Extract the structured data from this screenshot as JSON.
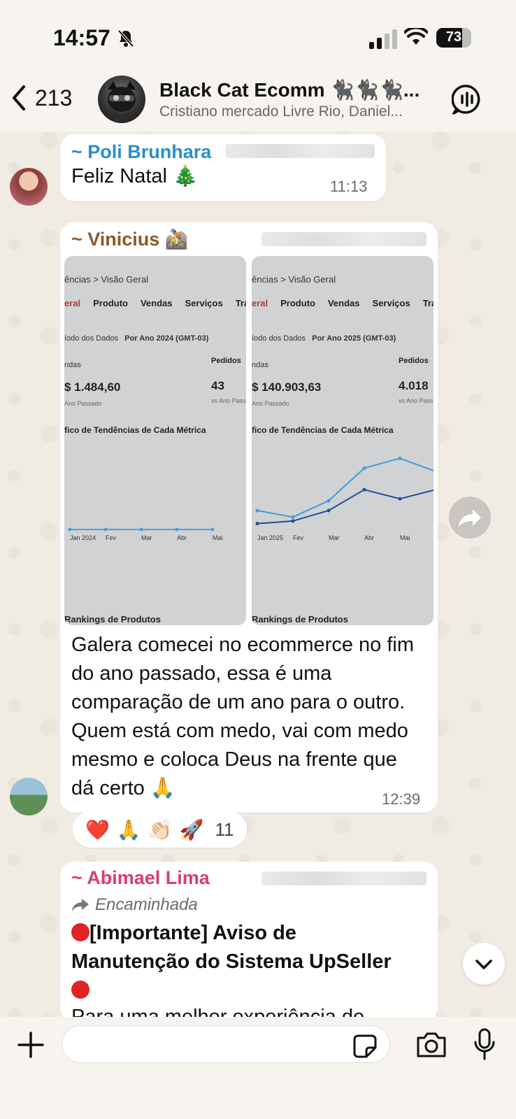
{
  "status_bar": {
    "time": "14:57",
    "battery": "73",
    "battery_level": 0.73,
    "signal_bars_active": 2
  },
  "header": {
    "back_count": "213",
    "group_name": "Black Cat Ecomm 🐈‍⬛🐈‍⬛🐈‍⬛...",
    "group_subtitle": "Cristiano mercado Livre Rio, Daniel..."
  },
  "messages": [
    {
      "sender": "~ Poli Brunhara",
      "sender_color": "#2a8fc7",
      "text": "Feliz Natal 🎄",
      "time": "11:13"
    },
    {
      "sender": "~ Vinicius 🚵🏻",
      "sender_color": "#8a5a2b",
      "text": "Galera comecei no ecommerce no fim do ano passado, essa é uma comparação de um ano para o outro. Quem está com medo, vai com medo mesmo e coloca Deus na frente que dá certo 🙏",
      "time": "12:39",
      "images": [
        {
          "breadcrumb": "ências  >  Visão Geral",
          "tabs": [
            "eral",
            "Produto",
            "Vendas",
            "Serviços",
            "Tráfeg"
          ],
          "period_label": "íodo dos Dados",
          "period_value": "Por Ano  2024 (GMT-03)",
          "sales_label": "ndas",
          "sales_value": "$ 1.484,60",
          "sales_compare": "Ano Passado",
          "orders_label": "Pedidos",
          "orders_value": "43",
          "orders_compare": "vs Ano Pass",
          "chart_title": "fico de Tendências de Cada Métrica",
          "x_labels": [
            "Jan 2024",
            "Fev",
            "Mar",
            "Abr",
            "Mai"
          ],
          "series": [
            {
              "name": "Vendas",
              "color": "#4a9fd0",
              "values": [
                1,
                1,
                1,
                1,
                1
              ]
            }
          ],
          "rankings_label": "Rankings de Produtos"
        },
        {
          "breadcrumb": "ências  >  Visão Geral",
          "tabs": [
            "eral",
            "Produto",
            "Vendas",
            "Serviços",
            "Tráfeg"
          ],
          "period_label": "íodo dos Dados",
          "period_value": "Por Ano  2025 (GMT-03)",
          "sales_label": "ndas",
          "sales_value": "$ 140.903,63",
          "sales_compare": "Ano Passado",
          "orders_label": "Pedidos",
          "orders_value": "4.018",
          "orders_compare": "vs Ano Pass",
          "chart_title": "fico de Tendências de Cada Métrica",
          "x_labels": [
            "Jan 2025",
            "Fev",
            "Mar",
            "Abr",
            "Mai"
          ],
          "series": [
            {
              "name": "Vendas",
              "color": "#3aa0d8",
              "values": [
                30,
                20,
                45,
                95,
                110,
                90
              ]
            },
            {
              "name": "Pedidos",
              "color": "#1f4f9a",
              "values": [
                10,
                14,
                30,
                62,
                48,
                62
              ]
            }
          ],
          "rankings_label": "Rankings de Produtos"
        }
      ],
      "reactions": [
        "❤️",
        "🙏",
        "👏🏻",
        "🚀"
      ],
      "reaction_count": "11"
    },
    {
      "sender": "~ Abimael Lima",
      "sender_color": "#d63d7a",
      "forwarded_label": "Encaminhada",
      "title": "[Importante] Aviso de Manutenção do Sistema UpSeller",
      "text_preview": "Para uma melhor experiência de"
    }
  ],
  "input": {
    "placeholder": ""
  }
}
